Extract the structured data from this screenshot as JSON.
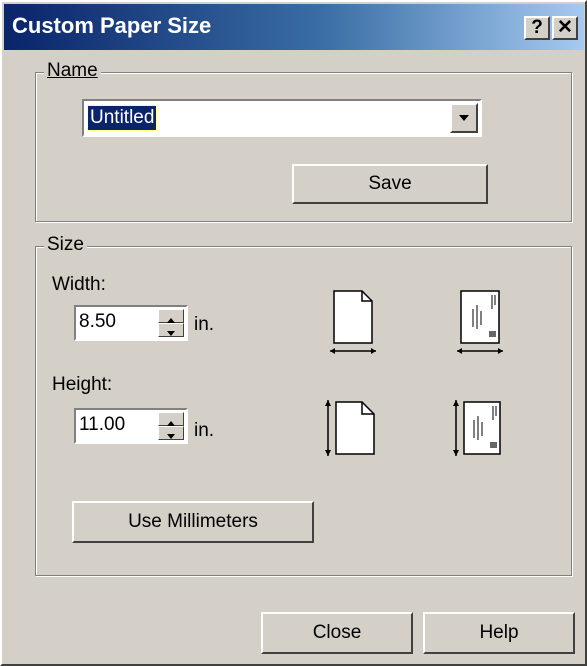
{
  "window": {
    "title": "Custom Paper Size",
    "help_glyph": "?",
    "close_glyph": "✕"
  },
  "name_group": {
    "legend": "Name",
    "selected_value": "Untitled",
    "save_label": "Save"
  },
  "size_group": {
    "legend": "Size",
    "width": {
      "label": "Width:",
      "value": "8.50",
      "unit": "in."
    },
    "height": {
      "label": "Height:",
      "value": "11.00",
      "unit": "in."
    },
    "use_mm_label": "Use Millimeters",
    "icons": [
      "portrait-width-icon",
      "envelope-width-icon",
      "portrait-height-icon",
      "envelope-height-icon"
    ]
  },
  "footer": {
    "close_label": "Close",
    "help_label": "Help"
  }
}
